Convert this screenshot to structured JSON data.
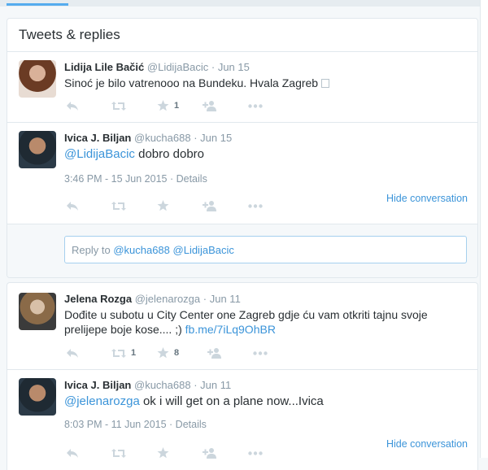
{
  "header": {
    "title": "Tweets & replies"
  },
  "tweets": [
    {
      "name": "Lidija Lile Bačić",
      "handle": "@LidijaBacic",
      "dot": "·",
      "time": "Jun 15",
      "text": "Sinoć je bilo vatrenooo na Bundeku. Hvala Zagreb",
      "retweets": "",
      "likes": "1"
    },
    {
      "name": "Ivica J. Biljan",
      "handle": "@kucha688",
      "dot": "·",
      "time": "Jun 15",
      "mention": "@LidijaBacic",
      "text": " dobro dobro",
      "timestamp": "3:46 PM - 15 Jun 2015",
      "details": "Details",
      "hide": "Hide conversation"
    },
    {
      "name": "Jelena Rozga",
      "handle": "@jelenarozga",
      "dot": "·",
      "time": "Jun 11",
      "text": "Dođite u subotu u City Center one Zagreb gdje ću vam otkriti tajnu svoje prelijepe boje kose.... ;) ",
      "link": "fb.me/7iLq9OhBR",
      "retweets": "1",
      "likes": "8"
    },
    {
      "name": "Ivica J. Biljan",
      "handle": "@kucha688",
      "dot": "·",
      "time": "Jun 11",
      "mention": "@jelenarozga",
      "text": " ok i will get on a plane now...Ivica",
      "timestamp": "8:03 PM - 11 Jun 2015",
      "details": "Details",
      "hide": "Hide conversation"
    }
  ],
  "reply": {
    "prefix": "Reply to ",
    "mention1": "@kucha688",
    "mention2": "@LidijaBacic"
  },
  "colors": {
    "link": "#3b94d9",
    "muted": "#8899a6",
    "icon": "#ccd6dd",
    "border": "#e1e8ed"
  }
}
